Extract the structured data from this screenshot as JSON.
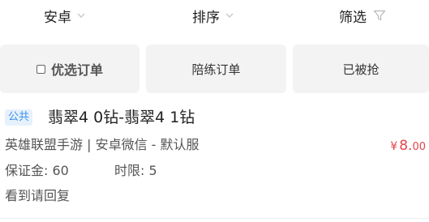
{
  "filter_bar": {
    "platform_label": "安卓",
    "sort_label": "排序",
    "filter_label": "筛选"
  },
  "tabs": [
    {
      "label": "优选订单",
      "checked": false
    },
    {
      "label": "陪练订单"
    },
    {
      "label": "已被抢"
    }
  ],
  "order": {
    "tag": "公共",
    "title": "翡翠4 0钻-翡翠4 1钻",
    "subtitle": "英雄联盟手游 | 安卓微信 - 默认服",
    "price": {
      "currency": "¥",
      "integer": "8.",
      "decimal": "00"
    },
    "deposit_label": "保证金:",
    "deposit_value": "60",
    "time_label": "时限:",
    "time_value": "5",
    "remark": "看到请回复"
  },
  "colors": {
    "price": "#e0454a",
    "tag_text": "#3a8ee6",
    "tag_bg": "#e6f1fd",
    "tab_bg": "#f3f3f3"
  }
}
